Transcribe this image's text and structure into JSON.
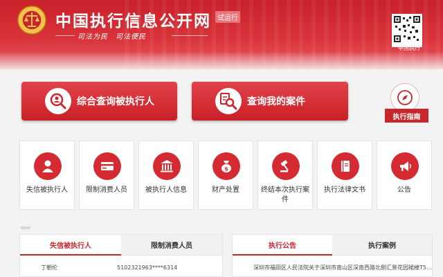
{
  "header": {
    "title": "中国执行信息公开网",
    "badge": "试运行",
    "slogan": "司法为民　司法便民",
    "qr_label": "中国执行"
  },
  "actions": {
    "search_executed": "综合查询被执行人",
    "my_case": "查询我的案件",
    "guide": "执行指南"
  },
  "categories": [
    {
      "label": "失信被执行人",
      "icon": "person-icon"
    },
    {
      "label": "限制消费人员",
      "icon": "card-icon"
    },
    {
      "label": "被执行人信息",
      "icon": "court-building-icon"
    },
    {
      "label": "财产处置",
      "icon": "money-bag-icon"
    },
    {
      "label": "终结本次执行案件",
      "icon": "gavel-icon"
    },
    {
      "label": "执行法律文书",
      "icon": "document-book-icon"
    },
    {
      "label": "公告",
      "icon": "megaphone-icon"
    }
  ],
  "left_panel": {
    "tabs": [
      "失信被执行人",
      "限制消费人员"
    ],
    "active_tab": 0,
    "rows": [
      {
        "name": "丁朝伦",
        "id": "5102321963****6314"
      }
    ]
  },
  "right_panel": {
    "tabs": [
      "执行公告",
      "执行案例"
    ],
    "active_tab": 0,
    "rows": [
      {
        "text": "深圳市福田区人民法院关于深圳市南山区深南西路北侧汇景花园裙楼T5..."
      }
    ]
  },
  "colors": {
    "primary_red": "#c9252c",
    "header_red": "#d9333a",
    "page_bg": "#f3f3f3"
  }
}
